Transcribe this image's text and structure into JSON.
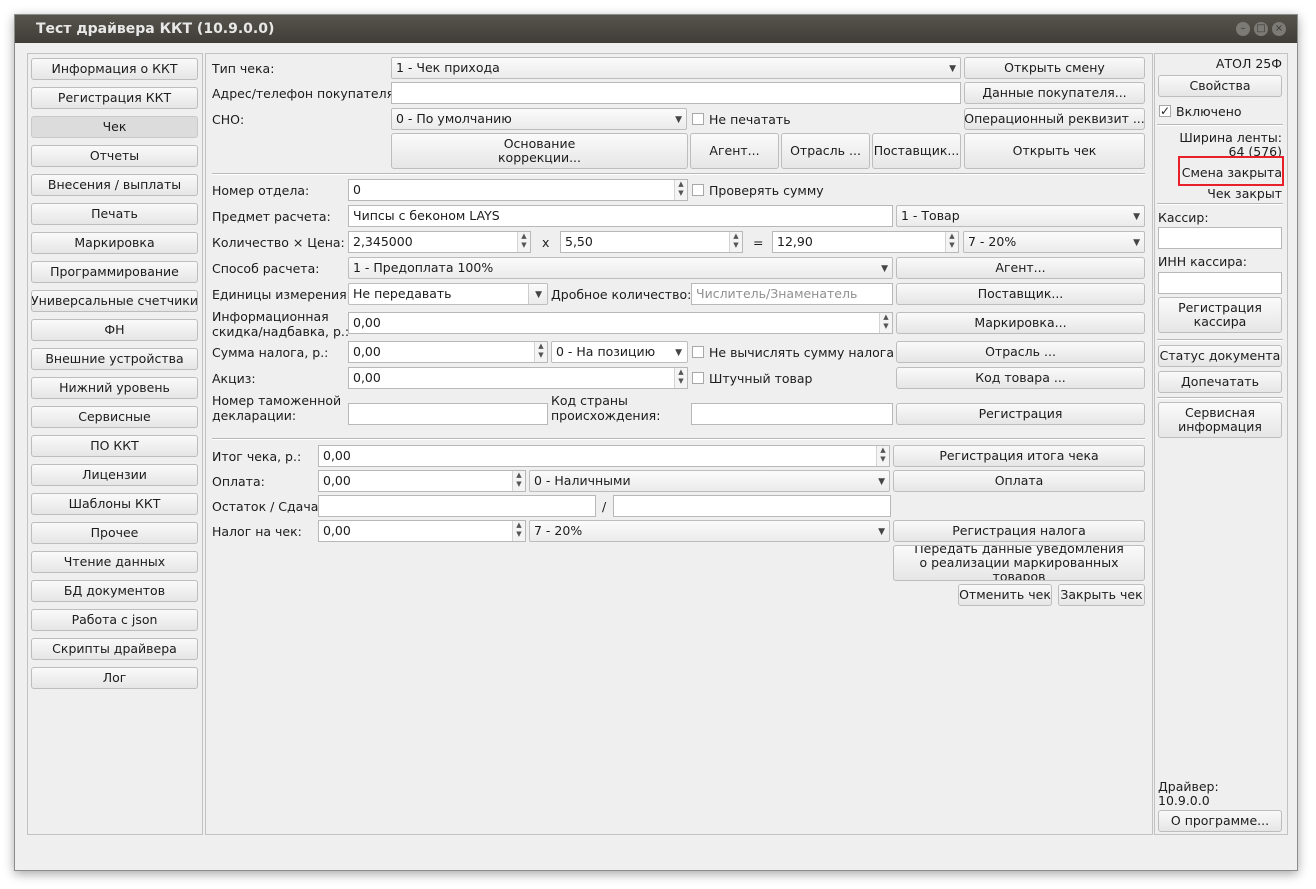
{
  "window": {
    "title": "Тест драйвера ККТ (10.9.0.0)"
  },
  "sidebar": {
    "items": [
      {
        "label": "Информация о ККТ"
      },
      {
        "label": "Регистрация ККТ"
      },
      {
        "label": "Чек",
        "active": true
      },
      {
        "label": "Отчеты"
      },
      {
        "label": "Внесения / выплаты"
      },
      {
        "label": "Печать"
      },
      {
        "label": "Маркировка"
      },
      {
        "label": "Программирование"
      },
      {
        "label": "Универсальные счетчики"
      },
      {
        "label": "ФН"
      },
      {
        "label": "Внешние устройства"
      },
      {
        "label": "Нижний уровень"
      },
      {
        "label": "Сервисные"
      },
      {
        "label": "ПО ККТ"
      },
      {
        "label": "Лицензии"
      },
      {
        "label": "Шаблоны ККТ"
      },
      {
        "label": "Прочее"
      },
      {
        "label": "Чтение данных"
      },
      {
        "label": "БД документов"
      },
      {
        "label": "Работа с json"
      },
      {
        "label": "Скрипты драйвера"
      },
      {
        "label": "Лог"
      }
    ]
  },
  "receipt": {
    "type_label": "Тип чека:",
    "type_value": "1 - Чек прихода",
    "open_shift_button": "Открыть смену",
    "buyer_address_label": "Адрес/телефон покупателя:",
    "buyer_address_value": "",
    "buyer_data_button": "Данные покупателя...",
    "sno_label": "СНО:",
    "sno_value": "0 - По умолчанию",
    "no_print_label": "Не печатать",
    "no_print_checked": false,
    "op_requisite_button": "Операционный реквизит ...",
    "correction_button_line1": "Основание",
    "correction_button_line2": "коррекции...",
    "agent_button": "Агент...",
    "industry_button": "Отрасль ...",
    "supplier_button": "Поставщик...",
    "open_receipt_button": "Открыть чек"
  },
  "position": {
    "department_label": "Номер отдела:",
    "department_value": "0",
    "check_sum_label": "Проверять сумму",
    "subject_label": "Предмет расчета:",
    "subject_value": "Чипсы с беконом LAYS",
    "subject_type_value": "1 - Товар",
    "qty_price_label": "Количество × Цена:",
    "qty_value": "2,345000",
    "x_sign": "x",
    "price_value": "5,50",
    "eq_sign": "=",
    "sum_value": "12,90",
    "tax_value": "7 - 20%",
    "payment_method_label": "Способ расчета:",
    "payment_method_value": "1 - Предоплата 100%",
    "agent_button": "Агент...",
    "units_label": "Единицы измерения:",
    "units_value": "Не передавать",
    "fraction_label": "Дробное количество:",
    "fraction_placeholder": "Числитель/Знаменатель",
    "supplier_button": "Поставщик...",
    "discount_label": "Информационная скидка/надбавка, р.:",
    "discount_value": "0,00",
    "marking_button": "Маркировка...",
    "tax_sum_label": "Сумма налога, р.:",
    "tax_sum_value": "0,00",
    "tax_mode_value": "0 - На позицию",
    "no_calc_tax_label": "Не вычислять сумму налога",
    "industry_button": "Отрасль ...",
    "excise_label": "Акциз:",
    "excise_value": "0,00",
    "piece_label": "Штучный товар",
    "product_code_button": "Код товара ...",
    "customs_label": "Номер таможенной декларации:",
    "customs_value": "",
    "country_label": "Код страны происхождения:",
    "country_value": "",
    "register_button": "Регистрация"
  },
  "totals": {
    "total_label": "Итог чека, р.:",
    "total_value": "0,00",
    "total_button": "Регистрация итога чека",
    "payment_label": "Оплата:",
    "payment_value": "0,00",
    "payment_type_value": "0 - Наличными",
    "payment_button": "Оплата",
    "remainder_label": "Остаток / Сдача:",
    "remainder_value": "",
    "slash": "/",
    "change_value": "",
    "receipt_tax_label": "Налог на чек:",
    "receipt_tax_value": "0,00",
    "receipt_tax_type_value": "7 - 20%",
    "tax_button": "Регистрация налога",
    "notify_button_line1": "Передать данные уведомления",
    "notify_button_line2": "о реализации маркированных товаров",
    "cancel_button": "Отменить чек",
    "close_button": "Закрыть чек"
  },
  "right_panel": {
    "device_name": "АТОЛ 25Ф",
    "properties_button": "Свойства",
    "enabled_label": "Включено",
    "enabled_checked": true,
    "tape_width_label": "Ширина ленты:",
    "tape_width_value": "64 (576)",
    "shift_status": "Смена закрыта",
    "receipt_status": "Чек закрыт",
    "cashier_label": "Кассир:",
    "cashier_value": "",
    "cashier_inn_label": "ИНН кассира:",
    "cashier_inn_value": "",
    "register_cashier_line1": "Регистрация",
    "register_cashier_line2": "кассира",
    "doc_status_button": "Статус документа",
    "reprint_button": "Допечатать",
    "service_info_line1": "Сервисная",
    "service_info_line2": "информация",
    "driver_label": "Драйвер:",
    "driver_version": "10.9.0.0",
    "about_button": "О программе..."
  }
}
